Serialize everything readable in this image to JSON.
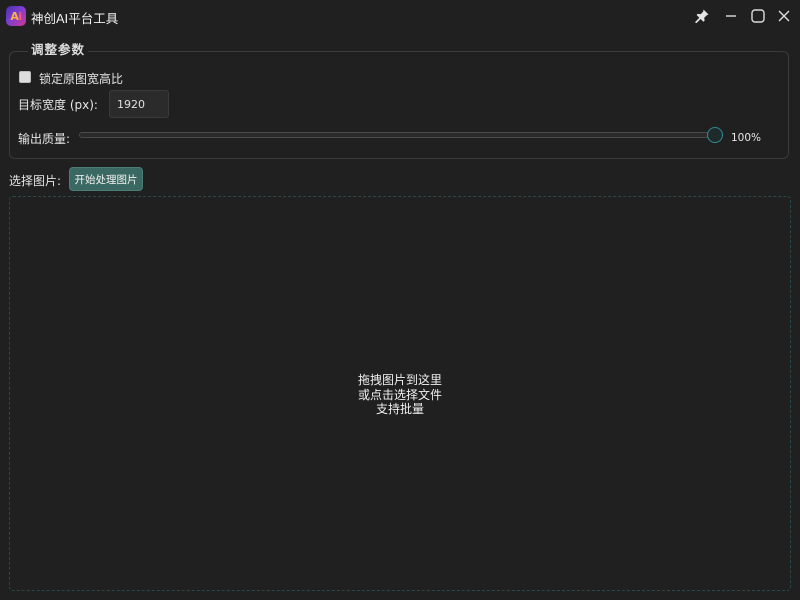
{
  "window": {
    "title": "神创AI平台工具",
    "logo_text_a": "A",
    "logo_text_i": "i",
    "controls": [
      "pin-icon",
      "minimize-icon",
      "maximize-icon",
      "close-icon"
    ]
  },
  "settings": {
    "group_title": "调整参数",
    "lock_ratio_label": "锁定原图宽高比",
    "lock_ratio_checked": false,
    "target_width_label": "目标宽度 (px):",
    "target_width_value": "1920",
    "quality_label": "输出质量:",
    "quality_value": 100,
    "quality_display": "100%"
  },
  "actions": {
    "select_label": "选择图片:",
    "process_button_label": "开始处理图片"
  },
  "dropzone": {
    "line1": "拖拽图片到这里",
    "line2": "或点击选择文件",
    "line3": "支持批量"
  },
  "colors": {
    "background": "#202020",
    "accent": "#2f8c95",
    "button": "#3a6862",
    "dropzone_border": "#2a4a4a"
  }
}
